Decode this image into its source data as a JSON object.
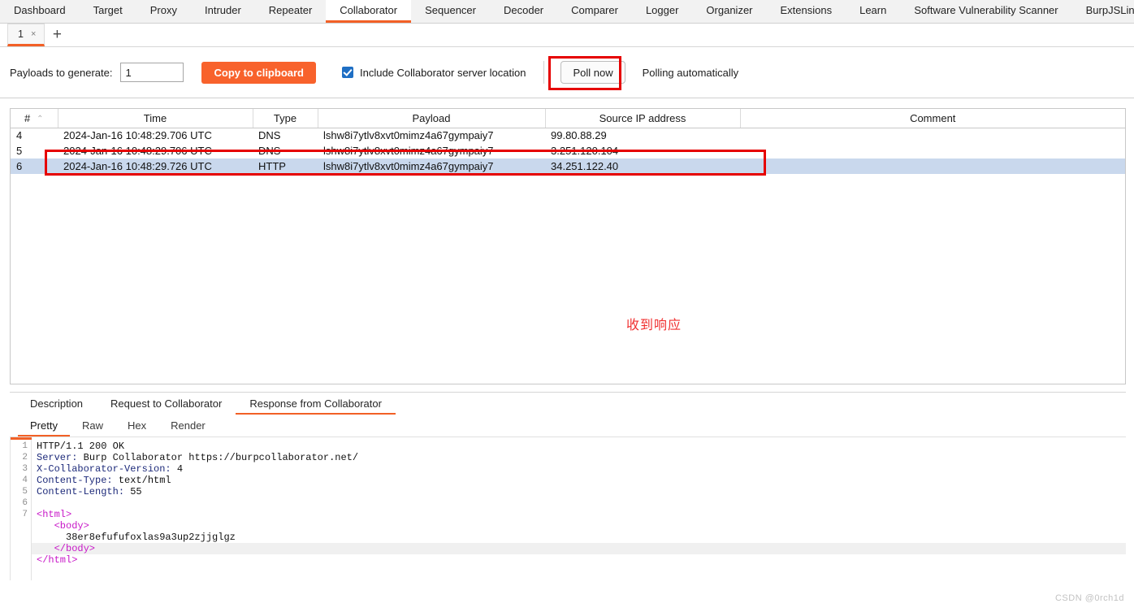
{
  "main_tabs": [
    {
      "label": "Dashboard",
      "active": false
    },
    {
      "label": "Target",
      "active": false
    },
    {
      "label": "Proxy",
      "active": false
    },
    {
      "label": "Intruder",
      "active": false
    },
    {
      "label": "Repeater",
      "active": false
    },
    {
      "label": "Collaborator",
      "active": true
    },
    {
      "label": "Sequencer",
      "active": false
    },
    {
      "label": "Decoder",
      "active": false
    },
    {
      "label": "Comparer",
      "active": false
    },
    {
      "label": "Logger",
      "active": false
    },
    {
      "label": "Organizer",
      "active": false
    },
    {
      "label": "Extensions",
      "active": false
    },
    {
      "label": "Learn",
      "active": false
    },
    {
      "label": "Software Vulnerability Scanner",
      "active": false
    },
    {
      "label": "BurpJSLinkFind",
      "active": false
    }
  ],
  "session_tabs": {
    "tab_label": "1",
    "close_glyph": "×",
    "add_glyph": "+"
  },
  "toolbar": {
    "payloads_label": "Payloads to generate:",
    "payloads_value": "1",
    "payloads_placeholder": "1",
    "copy_button": "Copy to clipboard",
    "include_location_label": "Include Collaborator server location",
    "include_location_checked": true,
    "poll_now_button": "Poll now",
    "polling_status": "Polling automatically",
    "accent_color": "#f8622c"
  },
  "table": {
    "columns": [
      "#",
      "Time",
      "Type",
      "Payload",
      "Source IP address",
      "Comment"
    ],
    "sort_caret": "⌃",
    "rows": [
      {
        "num": "4",
        "time": "2024-Jan-16 10:48:29.706 UTC",
        "type": "DNS",
        "payload": "lshw8i7ytlv8xvt0mimz4a67gympaiy7",
        "ip": "99.80.88.29",
        "comment": "",
        "selected": false
      },
      {
        "num": "5",
        "time": "2024-Jan-16 10:48:29.706 UTC",
        "type": "DNS",
        "payload": "lshw8i7ytlv8xvt0mimz4a67gympaiy7",
        "ip": "3.251.120.104",
        "comment": "",
        "selected": false
      },
      {
        "num": "6",
        "time": "2024-Jan-16 10:48:29.726 UTC",
        "type": "HTTP",
        "payload": "lshw8i7ytlv8xvt0mimz4a67gympaiy7",
        "ip": "34.251.122.40",
        "comment": "",
        "selected": true
      }
    ]
  },
  "annotation": {
    "chinese_note": "收到响应",
    "color": "#f03030"
  },
  "detail": {
    "tabs": [
      {
        "label": "Description",
        "active": false
      },
      {
        "label": "Request to Collaborator",
        "active": false
      },
      {
        "label": "Response from Collaborator",
        "active": true
      }
    ],
    "view_tabs": [
      {
        "label": "Pretty",
        "active": true
      },
      {
        "label": "Raw",
        "active": false
      },
      {
        "label": "Hex",
        "active": false
      },
      {
        "label": "Render",
        "active": false
      }
    ],
    "line_numbers": [
      "1",
      "2",
      "3",
      "4",
      "5",
      "6",
      "7"
    ],
    "code": [
      {
        "n": "1",
        "text": "HTTP/1.1 200 OK",
        "kind": "plain",
        "hl": false
      },
      {
        "n": "2",
        "key": "Server:",
        "val": " Burp Collaborator https://burpcollaborator.net/",
        "kind": "header",
        "hl": false
      },
      {
        "n": "3",
        "key": "X-Collaborator-Version:",
        "val": " 4",
        "kind": "header",
        "hl": false
      },
      {
        "n": "4",
        "key": "Content-Type:",
        "val": " text/html",
        "kind": "header",
        "hl": false
      },
      {
        "n": "5",
        "key": "Content-Length:",
        "val": " 55",
        "kind": "header",
        "hl": false
      },
      {
        "n": "6",
        "text": "",
        "kind": "plain",
        "hl": false
      },
      {
        "n": "7",
        "text": "<html>",
        "kind": "tag",
        "hl": false
      },
      {
        "n": "",
        "text": "   <body>",
        "kind": "tag",
        "hl": false
      },
      {
        "n": "",
        "text": "     38er8efufufoxlas9a3up2zjjglgz",
        "kind": "plain",
        "hl": false
      },
      {
        "n": "",
        "text": "   </body>",
        "kind": "tag",
        "hl": true
      },
      {
        "n": "",
        "text": "</html>",
        "kind": "tag",
        "hl": false
      }
    ]
  },
  "watermark": "CSDN @0rch1d"
}
